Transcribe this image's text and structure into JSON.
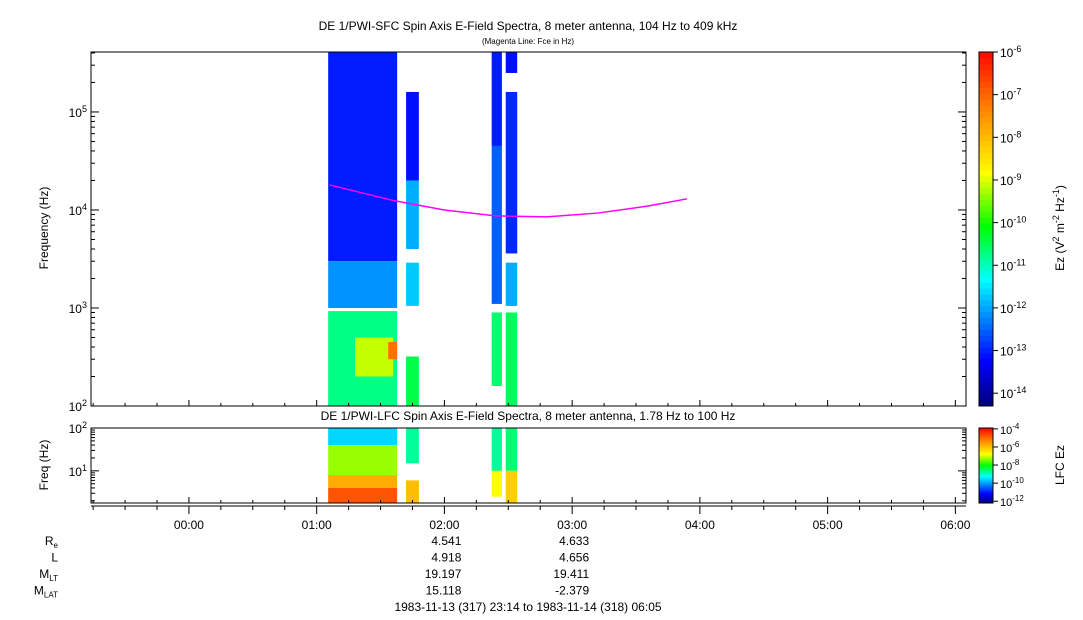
{
  "chart_data": [
    {
      "type": "heatmap",
      "title": "DE 1/PWI-SFC  Spin Axis E-Field Spectra, 8 meter antenna, 104 Hz to 409 kHz",
      "subtitle": "(Magenta Line: Fce in Hz)",
      "ylabel": "Frequency (Hz)",
      "yscale": "log",
      "ylim": [
        100,
        409000
      ],
      "yticks": [
        {
          "v": 100,
          "exp": "2"
        },
        {
          "v": 1000,
          "exp": "3"
        },
        {
          "v": 10000,
          "exp": "4"
        },
        {
          "v": 100000,
          "exp": "5"
        }
      ],
      "colorbar": {
        "label": "Ez (V2 m-2 Hz-1)",
        "label_parts": [
          "Ez (V",
          "2",
          " m",
          "-2",
          " Hz",
          "-1",
          ")"
        ],
        "log_range": [
          -14.3,
          -6
        ],
        "ticks": [
          {
            "v": -6,
            "exp": "-6"
          },
          {
            "v": -7,
            "exp": "-7"
          },
          {
            "v": -8,
            "exp": "-8"
          },
          {
            "v": -9,
            "exp": "-9"
          },
          {
            "v": -10,
            "exp": "-10"
          },
          {
            "v": -11,
            "exp": "-11"
          },
          {
            "v": -12,
            "exp": "-12"
          },
          {
            "v": -13,
            "exp": "-13"
          },
          {
            "v": -14,
            "exp": "-14"
          }
        ]
      },
      "blocks": [
        {
          "t": [
            1.09,
            1.63
          ],
          "f": [
            3000,
            409000
          ],
          "log_ez": -13.1
        },
        {
          "t": [
            1.09,
            1.63
          ],
          "f": [
            1000,
            3000
          ],
          "log_ez": -12.2
        },
        {
          "t": [
            1.09,
            1.63
          ],
          "f": [
            100,
            930
          ],
          "log_ez": -10.8
        },
        {
          "t": [
            1.3,
            1.6
          ],
          "f": [
            200,
            500
          ],
          "log_ez": -9.2
        },
        {
          "t": [
            1.56,
            1.63
          ],
          "f": [
            300,
            450
          ],
          "log_ez": -7.2
        },
        {
          "t": [
            1.7,
            1.8
          ],
          "f": [
            20000,
            160000
          ],
          "log_ez": -13.2
        },
        {
          "t": [
            1.7,
            1.8
          ],
          "f": [
            4000,
            20000
          ],
          "log_ez": -12.0
        },
        {
          "t": [
            1.7,
            1.8
          ],
          "f": [
            1050,
            2900
          ],
          "log_ez": -11.8
        },
        {
          "t": [
            1.7,
            1.8
          ],
          "f": [
            100,
            320
          ],
          "log_ez": -10.5
        },
        {
          "t": [
            2.37,
            2.45
          ],
          "f": [
            45000,
            409000
          ],
          "log_ez": -13.1
        },
        {
          "t": [
            2.37,
            2.45
          ],
          "f": [
            1100,
            45000
          ],
          "log_ez": -12.6
        },
        {
          "t": [
            2.37,
            2.45
          ],
          "f": [
            160,
            900
          ],
          "log_ez": -10.7
        },
        {
          "t": [
            2.48,
            2.57
          ],
          "f": [
            250000,
            409000
          ],
          "log_ez": -13.2
        },
        {
          "t": [
            2.48,
            2.57
          ],
          "f": [
            3600,
            160000
          ],
          "log_ez": -13.0
        },
        {
          "t": [
            2.48,
            2.57
          ],
          "f": [
            1050,
            2900
          ],
          "log_ez": -12.0
        },
        {
          "t": [
            2.48,
            2.57
          ],
          "f": [
            100,
            900
          ],
          "log_ez": -10.6
        }
      ],
      "fce_line": {
        "color": "#ff00ff",
        "t": [
          1.1,
          1.6,
          2.0,
          2.4,
          2.8,
          3.2,
          3.6,
          3.9
        ],
        "f": [
          18000,
          12500,
          10000,
          8700,
          8500,
          9300,
          11000,
          13000
        ]
      }
    },
    {
      "type": "heatmap",
      "title": "DE 1/PWI-LFC  Spin Axis E-Field Spectra, 8 meter antenna, 1.78 Hz to 100 Hz",
      "ylabel": "Freq (Hz)",
      "yscale": "log",
      "ylim": [
        1.78,
        100
      ],
      "yticks": [
        {
          "v": 10,
          "exp": "1"
        },
        {
          "v": 100,
          "exp": "2"
        }
      ],
      "colorbar": {
        "label": "LFC Ez",
        "log_range": [
          -12.2,
          -3.9
        ],
        "ticks": [
          {
            "v": -4,
            "exp": "-4"
          },
          {
            "v": -6,
            "exp": "-6"
          },
          {
            "v": -8,
            "exp": "-8"
          },
          {
            "v": -10,
            "exp": "-10"
          },
          {
            "v": -12,
            "exp": "-12"
          }
        ]
      },
      "blocks": [
        {
          "t": [
            1.09,
            1.63
          ],
          "f": [
            40,
            100
          ],
          "log_ez": -9.6
        },
        {
          "t": [
            1.09,
            1.63
          ],
          "f": [
            8,
            40
          ],
          "log_ez": -7.3
        },
        {
          "t": [
            1.09,
            1.63
          ],
          "f": [
            4,
            8
          ],
          "log_ez": -5.8
        },
        {
          "t": [
            1.09,
            1.63
          ],
          "f": [
            1.78,
            4
          ],
          "log_ez": -4.8
        },
        {
          "t": [
            1.7,
            1.8
          ],
          "f": [
            15,
            100
          ],
          "log_ez": -8.8
        },
        {
          "t": [
            1.7,
            1.8
          ],
          "f": [
            1.78,
            6
          ],
          "log_ez": -6.0
        },
        {
          "t": [
            2.37,
            2.45
          ],
          "f": [
            10,
            100
          ],
          "log_ez": -8.8
        },
        {
          "t": [
            2.37,
            2.45
          ],
          "f": [
            2.5,
            10
          ],
          "log_ez": -6.8
        },
        {
          "t": [
            2.48,
            2.57
          ],
          "f": [
            10,
            100
          ],
          "log_ez": -8.6
        },
        {
          "t": [
            2.48,
            2.57
          ],
          "f": [
            1.78,
            10
          ],
          "log_ez": -6.2
        }
      ]
    }
  ],
  "xaxis": {
    "range_hours": [
      -0.7667,
      6.0833
    ],
    "ticks": [
      {
        "v": 0,
        "label": "00:00"
      },
      {
        "v": 1,
        "label": "01:00"
      },
      {
        "v": 2,
        "label": "02:00"
      },
      {
        "v": 3,
        "label": "03:00"
      },
      {
        "v": 4,
        "label": "04:00"
      },
      {
        "v": 5,
        "label": "05:00"
      },
      {
        "v": 6,
        "label": "06:00"
      }
    ]
  },
  "ephemeris": {
    "rows": [
      {
        "name": "R",
        "sub": "e",
        "values": [
          "4.541",
          "4.633"
        ]
      },
      {
        "name": "L",
        "sub": "",
        "values": [
          "4.918",
          "4.656"
        ]
      },
      {
        "name": "M",
        "sub": "LT",
        "values": [
          "19.197",
          "19.411"
        ]
      },
      {
        "name": "M",
        "sub": "LAT",
        "values": [
          "15.118",
          "-2.379"
        ]
      }
    ],
    "at_hours": [
      2,
      3
    ]
  },
  "time_range": "1983-11-13 (317) 23:14 to 1983-11-14 (318) 06:05"
}
